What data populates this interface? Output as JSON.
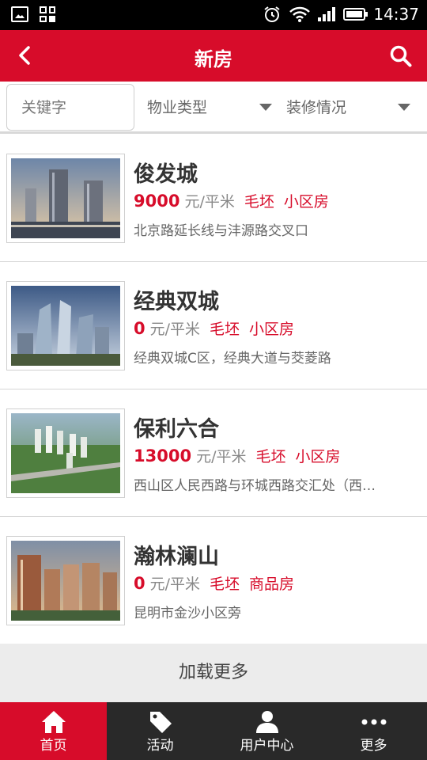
{
  "status_bar": {
    "time": "14:37"
  },
  "header": {
    "title": "新房"
  },
  "filters": {
    "keyword_placeholder": "关键字",
    "property_type": "物业类型",
    "decoration": "装修情况"
  },
  "listings": [
    {
      "name": "俊发城",
      "price": "9000",
      "unit": "元/平米",
      "tag1": "毛坯",
      "tag2": "小区房",
      "address": "北京路延长线与沣源路交叉口"
    },
    {
      "name": "经典双城",
      "price": "0",
      "unit": "元/平米",
      "tag1": "毛坯",
      "tag2": "小区房",
      "address": "经典双城C区，经典大道与茭菱路"
    },
    {
      "name": "保利六合",
      "price": "13000",
      "unit": "元/平米",
      "tag1": "毛坯",
      "tag2": "小区房",
      "address": "西山区人民西路与环城西路交汇处（西…"
    },
    {
      "name": "瀚林澜山",
      "price": "0",
      "unit": "元/平米",
      "tag1": "毛坯",
      "tag2": "商品房",
      "address": "昆明市金沙小区旁"
    }
  ],
  "load_more": "加载更多",
  "tabs": [
    {
      "label": "首页",
      "icon": "home-icon"
    },
    {
      "label": "活动",
      "icon": "tag-icon"
    },
    {
      "label": "用户中心",
      "icon": "user-icon"
    },
    {
      "label": "更多",
      "icon": "more-icon"
    }
  ],
  "colors": {
    "brand": "#d70c2a",
    "tabbar": "#292929"
  }
}
